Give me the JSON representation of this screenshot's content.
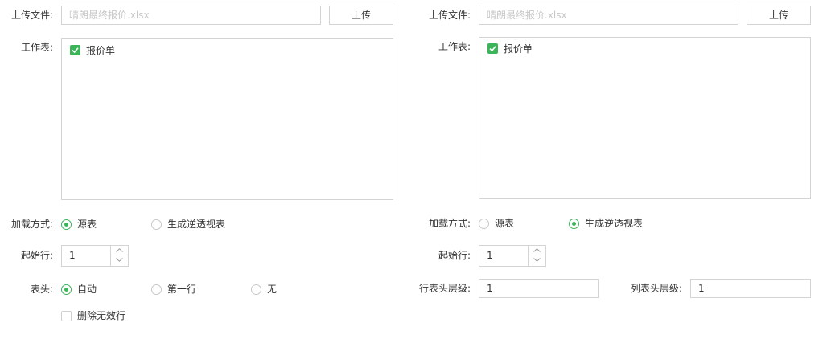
{
  "left": {
    "upload": {
      "label": "上传文件:",
      "placeholder": "晴朗最终报价.xlsx",
      "button": "上传"
    },
    "worksheet": {
      "label": "工作表:",
      "items": [
        {
          "label": "报价单",
          "checked": true
        }
      ]
    },
    "load_mode": {
      "label": "加载方式:",
      "options": [
        "源表",
        "生成逆透视表"
      ],
      "selected": "源表"
    },
    "start_row": {
      "label": "起始行:",
      "value": "1"
    },
    "header": {
      "label": "表头:",
      "options": [
        "自动",
        "第一行",
        "无"
      ],
      "selected": "自动"
    },
    "delete_invalid": {
      "label": "删除无效行",
      "checked": false
    }
  },
  "right": {
    "upload": {
      "label": "上传文件:",
      "placeholder": "晴朗最终报价.xlsx",
      "button": "上传"
    },
    "worksheet": {
      "label": "工作表:",
      "items": [
        {
          "label": "报价单",
          "checked": true
        }
      ]
    },
    "load_mode": {
      "label": "加载方式:",
      "options": [
        "源表",
        "生成逆透视表"
      ],
      "selected": "生成逆透视表"
    },
    "start_row": {
      "label": "起始行:",
      "value": "1"
    },
    "row_header_level": {
      "label": "行表头层级:",
      "value": "1"
    },
    "col_header_level": {
      "label": "列表头层级:",
      "value": "1"
    }
  },
  "colors": {
    "accent": "#3cb55a",
    "border": "#d4d4d4",
    "placeholder": "#c8c8c8"
  }
}
